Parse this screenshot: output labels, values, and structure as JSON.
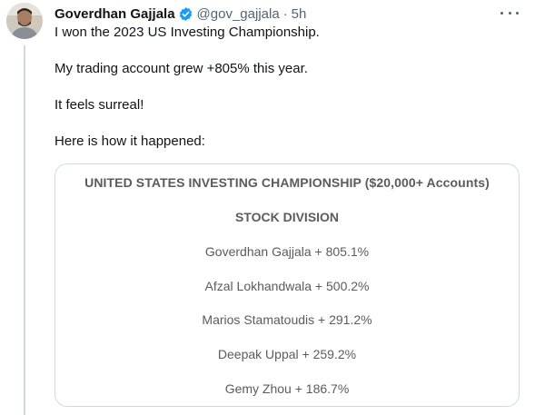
{
  "author": {
    "name": "Goverdhan Gajjala",
    "handle": "@gov_gajjala",
    "separator": "·",
    "time": "5h"
  },
  "tweet": {
    "paragraphs": [
      "I won the 2023 US Investing Championship.",
      "My trading account grew +805% this year.",
      "It feels surreal!",
      "Here is how it happened:"
    ]
  },
  "card": {
    "title": "UNITED STATES INVESTING CHAMPIONSHIP ($20,000+ Accounts)",
    "subtitle": "STOCK DIVISION",
    "results": [
      "Goverdhan Gajjala + 805.1%",
      "Afzal Lokhandwala + 500.2%",
      "Marios Stamatoudis + 291.2%",
      "Deepak Uppal + 259.2%",
      "Gemy Zhou + 186.7%"
    ]
  },
  "colors": {
    "verified": "#1d9bf0",
    "secondary_text": "#536471",
    "card_text": "#5b5b5b",
    "border": "#cfd9de"
  },
  "icons": {
    "verified": "verified-badge-icon",
    "more": "more-options-icon"
  }
}
